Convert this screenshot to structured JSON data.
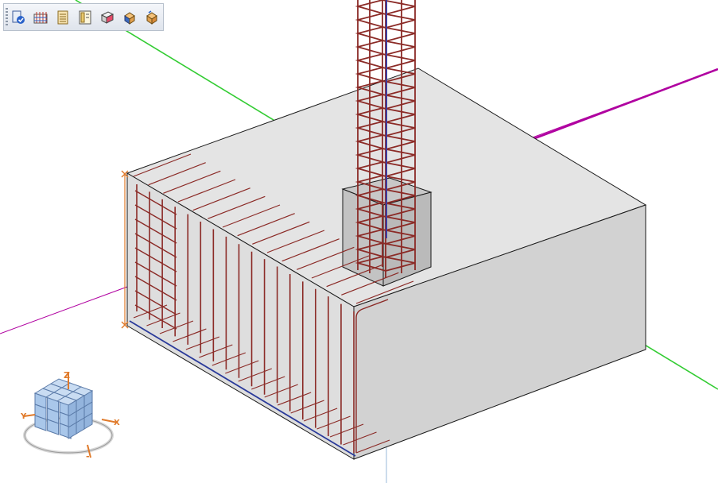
{
  "toolbar": {
    "buttons": [
      {
        "id": "select-tool",
        "icon": "select-check-icon"
      },
      {
        "id": "rebar-tool",
        "icon": "rebar-mesh-icon"
      },
      {
        "id": "layer-tool",
        "icon": "layer-stack-icon"
      },
      {
        "id": "frame-tool",
        "icon": "frame-view-icon"
      },
      {
        "id": "section-tool",
        "icon": "section-block-icon"
      },
      {
        "id": "solid-tool-a",
        "icon": "solid-edit-icon"
      },
      {
        "id": "solid-tool-b",
        "icon": "solid-edit-alt-icon"
      }
    ]
  },
  "view_cube": {
    "axis_z": "Z",
    "axis_x": "X",
    "axis_y": "Y",
    "axis_neg": "-"
  },
  "colors": {
    "footing_fill": "#e2e2e2",
    "footing_side": "#cdcdcd",
    "edge": "#1a1a1a",
    "rebar": "#8b2a26",
    "axis_green": "#33cc33",
    "axis_magenta": "#b000a0",
    "blue_line": "#2a3a9a",
    "cube_blue": "#a9c7ea",
    "cube_orange": "#e07a2a"
  }
}
